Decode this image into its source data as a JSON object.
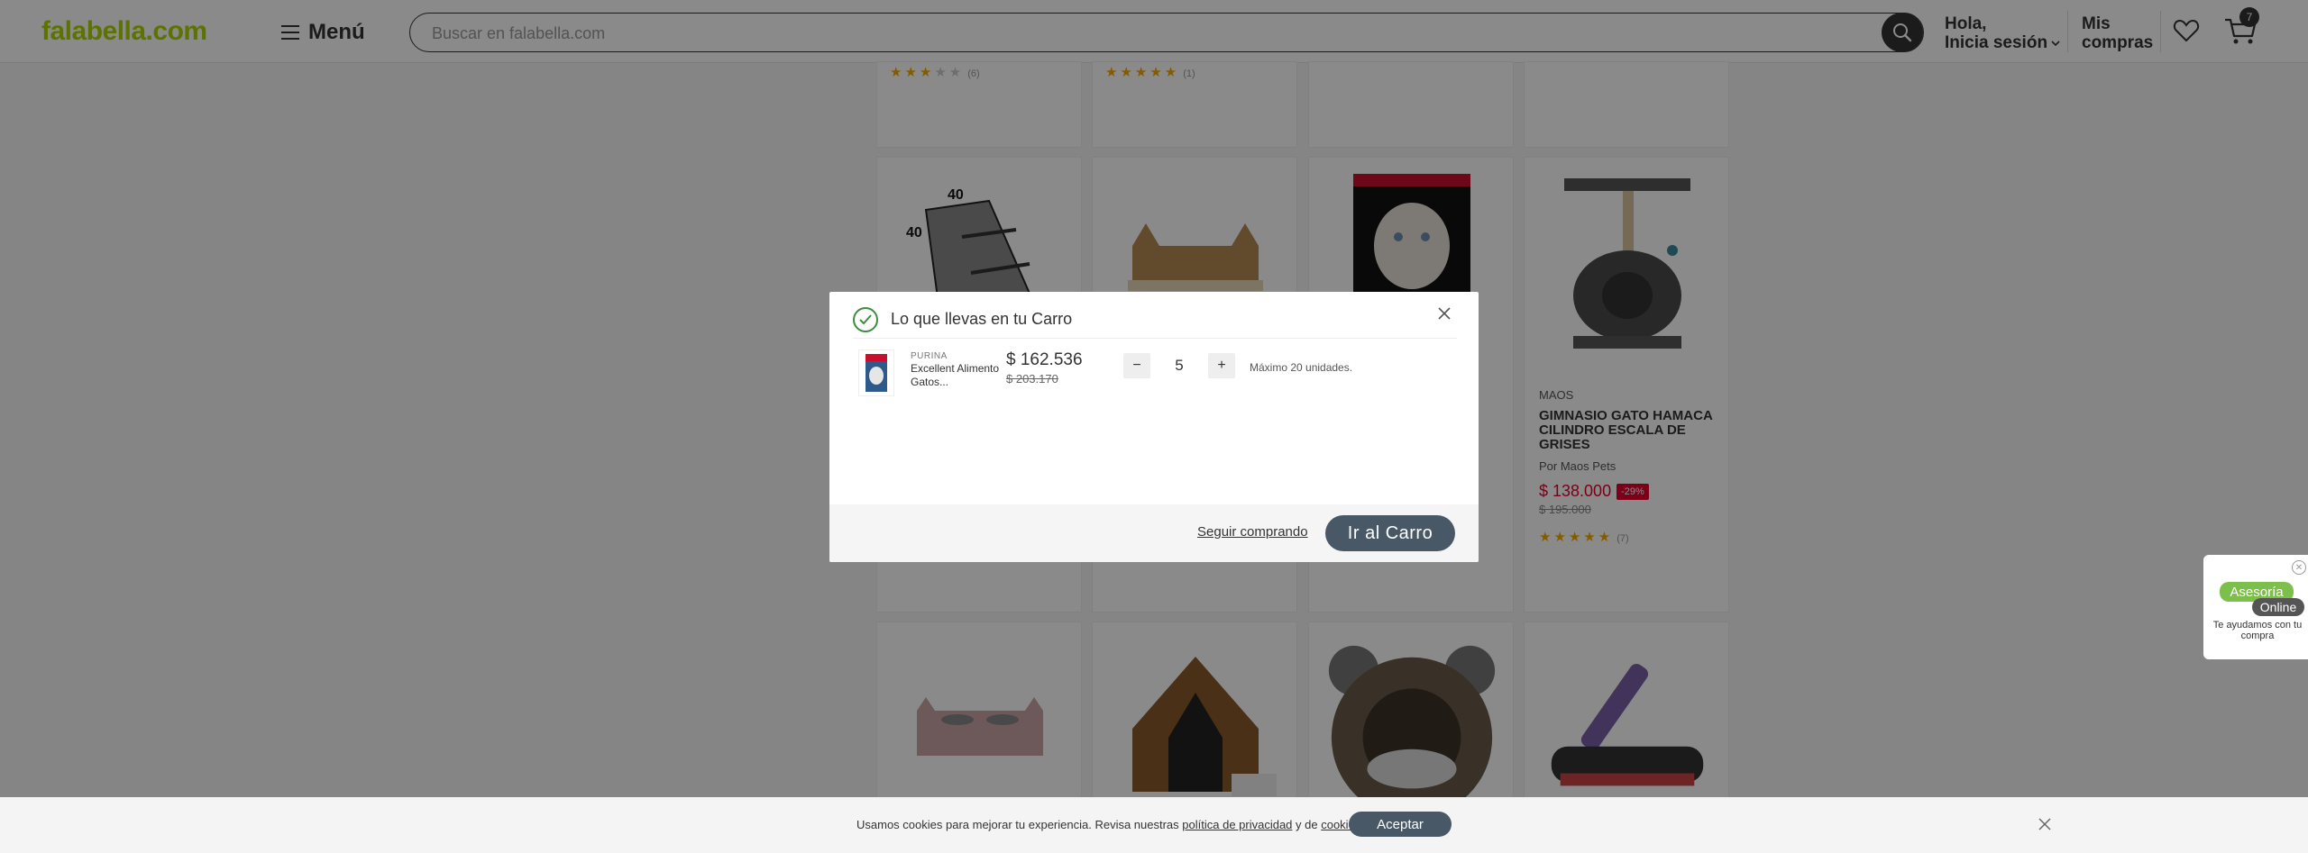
{
  "header": {
    "logo": "falabella.com",
    "menu_label": "Menú",
    "search_placeholder": "Buscar en falabella.com",
    "user_line1": "Hola,",
    "user_line2": "Inicia sesión",
    "orders_line1": "Mis",
    "orders_line2": "compras",
    "cart_count": "7"
  },
  "grid": {
    "top_row": [
      {
        "rating": 3,
        "count": "(6)"
      },
      {
        "rating": 5,
        "count": "(1)"
      }
    ],
    "featured": {
      "brand": "MAOS",
      "name": "GIMNASIO GATO HAMACA CILINDRO ESCALA DE GRISES",
      "seller": "Por Maos Pets",
      "price": "$ 138.000",
      "discount": "-29%",
      "old_price": "$ 195.000",
      "rating": 5,
      "count": "(7)"
    }
  },
  "modal": {
    "title": "Lo que llevas en tu Carro",
    "item": {
      "brand": "PURINA",
      "name": "Excellent Alimento Gatos...",
      "price": "$ 162.536",
      "old_price": "$ 203.170",
      "quantity": "5",
      "max_note": "Máximo 20 unidades."
    },
    "keep_shopping": "Seguir comprando",
    "go_to_cart": "Ir al Carro"
  },
  "assistant": {
    "badge1": "Asesoría",
    "badge2": "Online",
    "text": "Te ayudamos con tu compra"
  },
  "cookies": {
    "text_before": "Usamos cookies para mejorar tu experiencia. Revisa nuestras ",
    "privacy_link": "política de privacidad",
    "text_mid": " y de ",
    "cookies_link": "cookies",
    "text_end": ".",
    "accept": "Aceptar"
  },
  "colors": {
    "brand_green": "#aad500",
    "primary_button": "#495867",
    "discount_red": "#e4002b",
    "star": "#f5a800",
    "check_green": "#3d8c40"
  }
}
